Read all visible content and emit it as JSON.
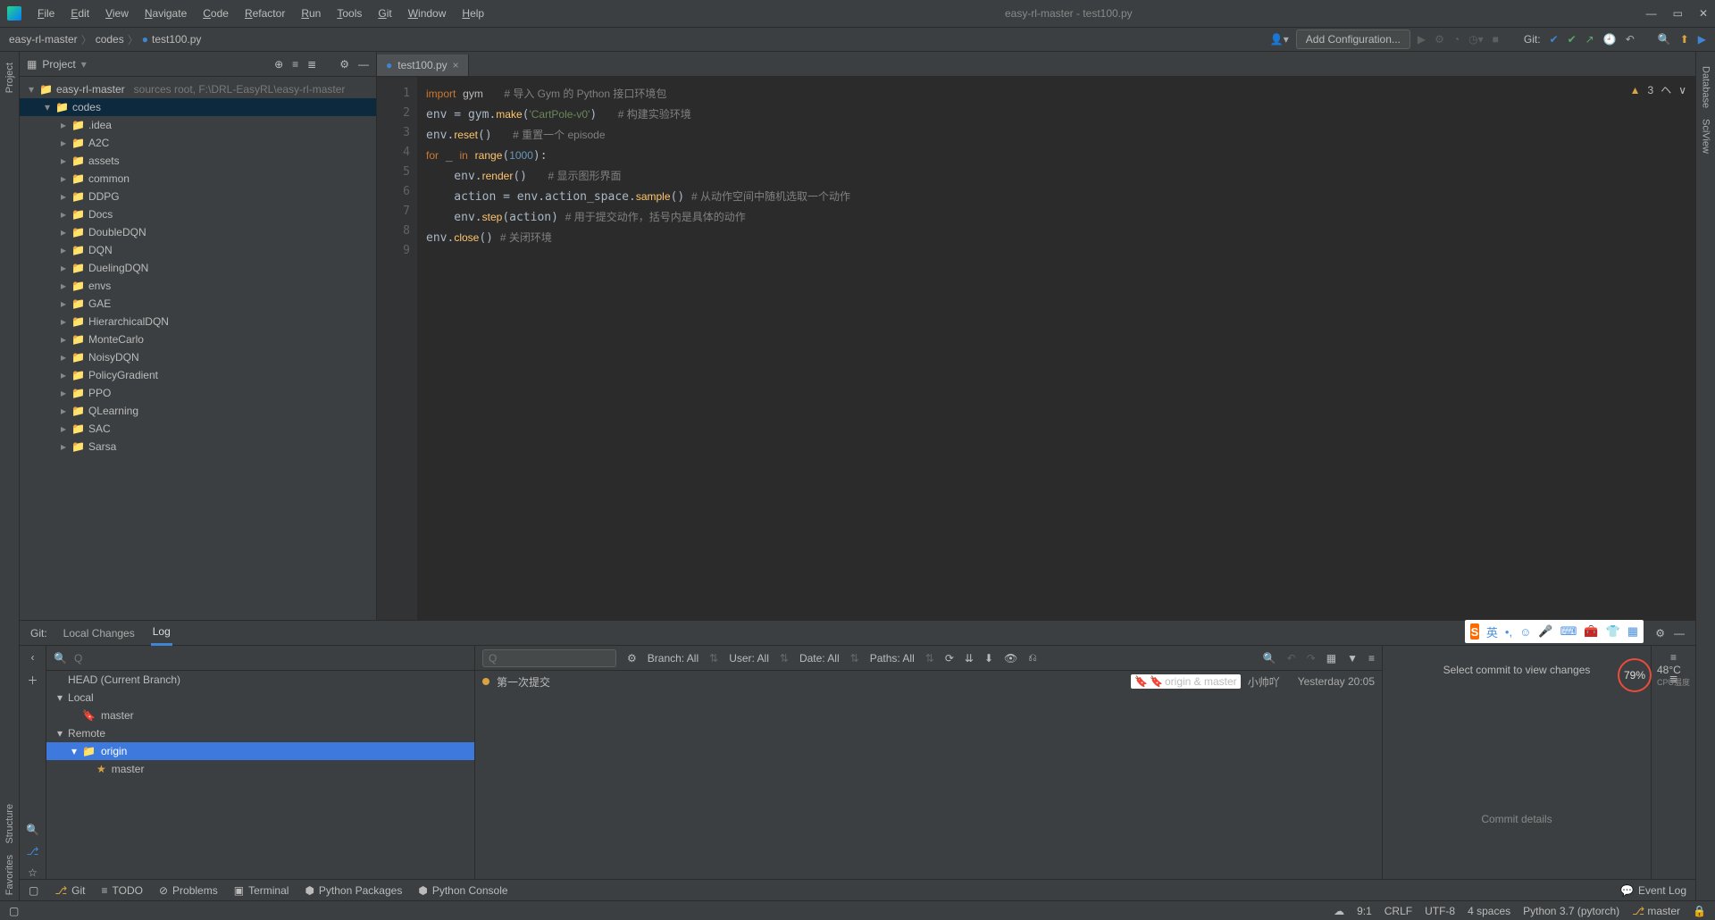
{
  "window": {
    "title": "easy-rl-master - test100.py"
  },
  "menu": [
    "File",
    "Edit",
    "View",
    "Navigate",
    "Code",
    "Refactor",
    "Run",
    "Tools",
    "Git",
    "Window",
    "Help"
  ],
  "breadcrumb": [
    "easy-rl-master",
    "codes",
    "test100.py"
  ],
  "navbar": {
    "add_config": "Add Configuration...",
    "git_label": "Git:"
  },
  "project_panel": {
    "title": "Project",
    "root": {
      "name": "easy-rl-master",
      "hint": "sources root,  F:\\DRL-EasyRL\\easy-rl-master"
    },
    "codes": "codes",
    "folders": [
      ".idea",
      "A2C",
      "assets",
      "common",
      "DDPG",
      "Docs",
      "DoubleDQN",
      "DQN",
      "DuelingDQN",
      "envs",
      "GAE",
      "HierarchicalDQN",
      "MonteCarlo",
      "NoisyDQN",
      "PolicyGradient",
      "PPO",
      "QLearning",
      "SAC",
      "Sarsa"
    ]
  },
  "editor": {
    "tab": "test100.py",
    "warn_count": "3",
    "lines": [
      {
        "n": 1,
        "html": "<span class='kw'>import</span> <span>gym</span>   <span class='cmt'># 导入 Gym 的 Python 接口环境包</span>"
      },
      {
        "n": 2,
        "html": "env = gym.<span class='fn'>make</span>(<span class='str'>'CartPole-v0'</span>)   <span class='cmt'># 构建实验环境</span>"
      },
      {
        "n": 3,
        "html": "env.<span class='fn'>reset</span>()   <span class='cmt'># 重置一个 episode</span>"
      },
      {
        "n": 4,
        "html": "<span class='kw'>for</span> _ <span class='kw'>in</span> <span class='fn'>range</span>(<span class='num'>1000</span>):"
      },
      {
        "n": 5,
        "html": "    env.<span class='fn'>render</span>()   <span class='cmt'># 显示图形界面</span>"
      },
      {
        "n": 6,
        "html": "    action = env.action_space.<span class='fn'>sample</span>() <span class='cmt'># 从动作空间中随机选取一个动作</span>"
      },
      {
        "n": 7,
        "html": "    env.<span class='fn'>step</span>(action) <span class='cmt'># 用于提交动作，括号内是具体的动作</span>"
      },
      {
        "n": 8,
        "html": "env.<span class='fn'>close</span>() <span class='cmt'># 关闭环境</span>"
      },
      {
        "n": 9,
        "html": ""
      }
    ]
  },
  "git_panel": {
    "label": "Git:",
    "tabs": [
      "Local Changes",
      "Log"
    ],
    "head": "HEAD (Current Branch)",
    "local": "Local",
    "local_branch": "master",
    "remote": "Remote",
    "origin": "origin",
    "origin_branch": "master",
    "filters": {
      "branch": "Branch: All",
      "user": "User: All",
      "date": "Date: All",
      "paths": "Paths: All"
    },
    "commit": {
      "msg": "第一次提交",
      "tag": "origin & master",
      "author": "小帅吖",
      "date": "Yesterday 20:05"
    },
    "right_msg": "Select commit to view changes",
    "right_detail": "Commit details"
  },
  "tool_windows": [
    "Git",
    "TODO",
    "Problems",
    "Terminal",
    "Python Packages",
    "Python Console"
  ],
  "event_log": "Event Log",
  "status": {
    "pos": "9:1",
    "eol": "CRLF",
    "enc": "UTF-8",
    "indent": "4 spaces",
    "interp": "Python 3.7 (pytorch)",
    "branch": "master"
  },
  "side_labels": {
    "project": "Project",
    "structure": "Structure",
    "favorites": "Favorites",
    "database": "Database",
    "sciview": "SciView"
  },
  "ime": {
    "s": "S",
    "lang": "英"
  },
  "cpu": {
    "pct": "79%",
    "temp": "48°C",
    "label": "CPU温度"
  },
  "search_placeholder": "Q"
}
